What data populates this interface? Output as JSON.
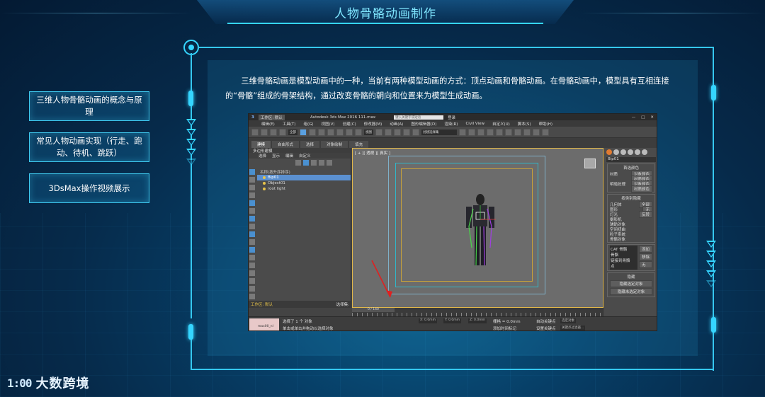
{
  "page": {
    "title": "人物骨骼动画制作",
    "intro": "三维骨骼动画是模型动画中的一种，当前有两种模型动画的方式：顶点动画和骨骼动画。在骨骼动画中，模型具有互相连接的“骨骼”组成的骨架结构，通过改变骨骼的朝向和位置来为模型生成动画。",
    "logo_text": "大数跨境",
    "logo_mark": "1:00"
  },
  "sidebar": {
    "items": [
      {
        "label": "三维人物骨骼动画的概念与原理"
      },
      {
        "label": "常见人物动画实现（行走、跑动、待机、跳跃）"
      },
      {
        "label": "3DsMax操作视频展示"
      }
    ]
  },
  "app": {
    "workspace": "工作区: 默认",
    "window_title": "Autodesk 3ds Max 2016    111.max",
    "search_placeholder": "键入关键字或短语",
    "login": "登录",
    "menu": [
      "编辑(E)",
      "工具(T)",
      "组(G)",
      "视图(V)",
      "创建(C)",
      "修改器(M)",
      "动画(A)",
      "图形编辑器(D)",
      "渲染(R)",
      "Civil View",
      "自定义(U)",
      "脚本(S)",
      "帮助(H)"
    ],
    "toolbar_dropdown_1": "全部",
    "toolbar_dropdown_2": "视图",
    "toolbar_dropdown_3": "创建选择集",
    "tabs": [
      "建模",
      "自由形式",
      "选择",
      "对象绘制",
      "填充"
    ],
    "sub_tab": "多边形建模",
    "scene_explorer_head": [
      "选择",
      "显示",
      "编辑",
      "自定义"
    ],
    "scene_list_header": "名称(按升序排序)",
    "scene_items": [
      {
        "name": "Bip01",
        "selected": true
      },
      {
        "name": "Object01",
        "selected": false
      },
      {
        "name": "root light",
        "selected": false
      }
    ],
    "viewport_label": "[ + ][ 透视 ][ 真实 ]",
    "frame_counter": "0 / 140",
    "left_bottom_workspace": "工作区: 默认",
    "left_bottom_select": "选择集:",
    "right_panel": {
      "object_name": "Bip01",
      "group1_title": "首选颜色",
      "group1_rows": [
        [
          "材质",
          "对象颜色"
        ],
        [
          "",
          "材质颜色"
        ],
        [
          "明暗处理",
          "对象颜色"
        ],
        [
          "",
          "材质颜色"
        ]
      ],
      "group2_title": "按类别隐藏",
      "group2_rows": [
        [
          "几何体",
          "全部"
        ],
        [
          "图形",
          "无"
        ],
        [
          "灯光",
          "反转"
        ],
        [
          "摄影机",
          ""
        ],
        [
          "辅助对象",
          ""
        ],
        [
          "空间扭曲",
          ""
        ],
        [
          "粒子系统",
          ""
        ],
        [
          "骨骼对象",
          ""
        ]
      ],
      "group3_lines": [
        "CAT 骨骼",
        "骨骼",
        "链接到骨骼",
        "点"
      ],
      "group3_buttons": [
        "添加",
        "移除",
        "无"
      ],
      "group4_title": "隐藏",
      "group4_buttons": [
        "隐藏选定对象",
        "隐藏未选定对象"
      ]
    },
    "status": {
      "maxscript": "max00_nl",
      "line1": "选择了 1 个 对象",
      "line2": "单击或单击并拖动以选择对象",
      "x": "X: 0.0mm",
      "y": "Y: 0.0mm",
      "z": "Z: 0.0mm",
      "grid": "栅格 = 0.0mm",
      "time_tag": "添加时间标记",
      "auto_key": "自动关键点",
      "set_key": "设置关键点",
      "key_filter": "选定对象",
      "key_filter2": "关键点过滤器..."
    }
  },
  "colors": {
    "accent": "#35d5ff",
    "panel": "#1e6ea0",
    "selection": "#5b90d0",
    "viewport_border": "#e2b84a"
  }
}
